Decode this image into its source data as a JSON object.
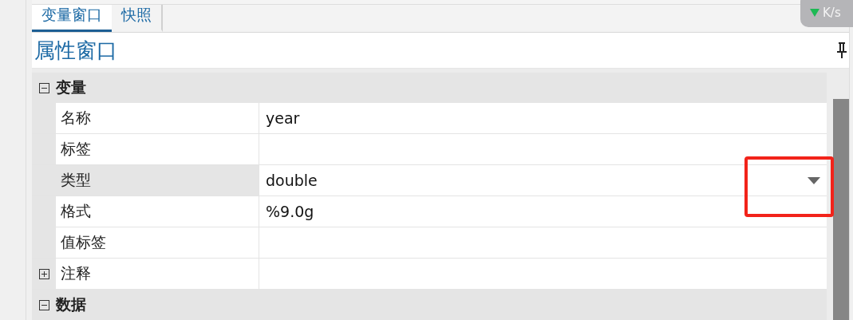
{
  "tabs": [
    {
      "label": "变量窗口",
      "selected": true
    },
    {
      "label": "快照",
      "selected": false
    }
  ],
  "speed_widget": {
    "text": "K/s"
  },
  "panel": {
    "title": "属性窗口"
  },
  "groups": [
    {
      "label": "变量",
      "expanded": true,
      "rows": [
        {
          "kind": "field",
          "name": "名称",
          "value": "year",
          "selected": false
        },
        {
          "kind": "field",
          "name": "标签",
          "selected": false
        },
        {
          "kind": "field",
          "name": "类型",
          "value": "double",
          "selected": true,
          "dropdown": true
        },
        {
          "kind": "field",
          "name": "格式",
          "value": "%9.0g",
          "selected": false
        },
        {
          "kind": "field",
          "name": "值标签",
          "selected": false
        },
        {
          "kind": "subgroup",
          "name": "注释",
          "expanded": false,
          "selected": false
        }
      ]
    },
    {
      "label": "数据",
      "expanded": true
    }
  ]
}
